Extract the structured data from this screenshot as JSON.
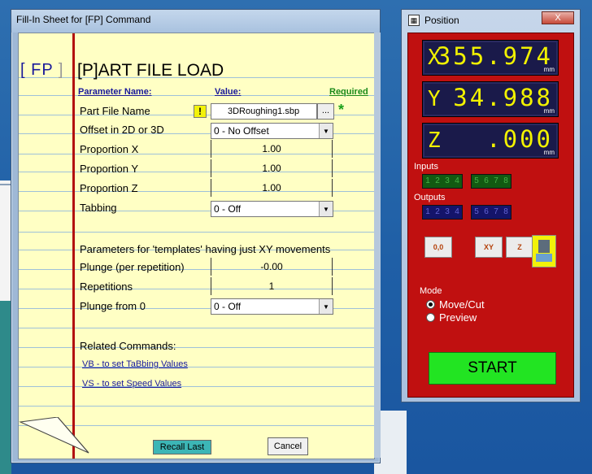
{
  "fill_in_window": {
    "title": "Fill-In Sheet for [FP] Command",
    "command_code": "FP",
    "left_bracket": "[",
    "right_bracket": "]",
    "heading": "[P]ART FILE LOAD",
    "headers": {
      "parameter": "Parameter Name:",
      "value": "Value:",
      "required": "Required"
    },
    "part_file": {
      "label": "Part File Name",
      "value": "3DRoughing1.sbp",
      "browse": "...",
      "warning": "!",
      "required_mark": "*"
    },
    "offset": {
      "label": "Offset in 2D or 3D",
      "value": "0 - No Offset"
    },
    "proportion_x": {
      "label": "Proportion X",
      "value": "1.00"
    },
    "proportion_y": {
      "label": "Proportion Y",
      "value": "1.00"
    },
    "proportion_z": {
      "label": "Proportion Z",
      "value": "1.00"
    },
    "tabbing": {
      "label": "Tabbing",
      "value": "0 - Off"
    },
    "templates_note": "Parameters for 'templates' having just XY movements",
    "plunge": {
      "label": "Plunge (per repetition)",
      "value": "-0.00"
    },
    "repetitions": {
      "label": "Repetitions",
      "value": "1"
    },
    "plunge_from_zero": {
      "label": "Plunge from 0",
      "value": "0 - Off"
    },
    "related_heading": "Related Commands:",
    "links": [
      "VB - to set TaBbing Values",
      "VS - to set Speed Values"
    ],
    "recall_button": "Recall Last",
    "cancel_button": "Cancel"
  },
  "position_window": {
    "title": "Position",
    "close": "X",
    "icon": "position-app-icon",
    "axes": [
      {
        "label": "X",
        "value": "355.974",
        "unit": "mm"
      },
      {
        "label": "Y",
        "value": "34.988",
        "unit": "mm"
      },
      {
        "label": "Z",
        "value": ".000",
        "unit": "mm"
      }
    ],
    "inputs_label": "Inputs",
    "inputs": [
      "1",
      "2",
      "3",
      "4",
      "5",
      "6",
      "7",
      "8"
    ],
    "outputs_label": "Outputs",
    "outputs": [
      "1",
      "2",
      "3",
      "4",
      "5",
      "6",
      "7",
      "8"
    ],
    "tool_buttons": {
      "zero": "0,0",
      "xy": "XY",
      "z": "Z"
    },
    "mode_label": "Mode",
    "mode_options": [
      "Move/Cut",
      "Preview"
    ],
    "selected_mode": "Move/Cut",
    "start_button": "START"
  },
  "colors": {
    "paper": "#ffffc4",
    "margin": "#b21010",
    "panel": "#c01010",
    "display": "#f2f200",
    "start": "#22e422"
  }
}
